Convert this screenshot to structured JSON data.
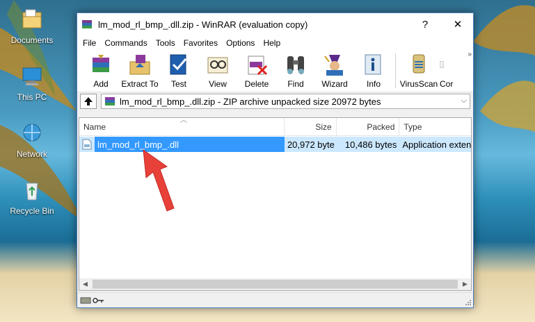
{
  "desktop": {
    "icons": [
      {
        "label": "Documents",
        "icon": "documents-folder-icon"
      },
      {
        "label": "This PC",
        "icon": "computer-icon"
      },
      {
        "label": "Network",
        "icon": "network-icon"
      },
      {
        "label": "Recycle Bin",
        "icon": "recycle-bin-icon"
      }
    ]
  },
  "window": {
    "title": "lm_mod_rl_bmp_.dll.zip - WinRAR (evaluation copy)",
    "help_button": "?",
    "close_button": "✕"
  },
  "menu": [
    "File",
    "Commands",
    "Tools",
    "Favorites",
    "Options",
    "Help"
  ],
  "toolbar": {
    "buttons": [
      {
        "label": "Add",
        "icon": "add-archive-icon"
      },
      {
        "label": "Extract To",
        "icon": "extract-to-icon"
      },
      {
        "label": "Test",
        "icon": "test-icon"
      },
      {
        "label": "View",
        "icon": "view-icon"
      },
      {
        "label": "Delete",
        "icon": "delete-icon"
      },
      {
        "label": "Find",
        "icon": "find-icon"
      },
      {
        "label": "Wizard",
        "icon": "wizard-icon"
      },
      {
        "label": "Info",
        "icon": "info-icon"
      },
      {
        "label": "VirusScan",
        "icon": "virusscan-icon"
      },
      {
        "label": "Cor",
        "icon": "comment-icon"
      }
    ],
    "overflow": "»"
  },
  "address": {
    "path": "lm_mod_rl_bmp_.dll.zip - ZIP archive unpacked size 20972 bytes"
  },
  "list": {
    "columns": [
      "Name",
      "Size",
      "Packed",
      "Type"
    ],
    "rows": [
      {
        "name": "lm_mod_rl_bmp_.dll",
        "size": "20,972 byte",
        "packed": "10,486 bytes",
        "type": "Application exten"
      }
    ]
  },
  "colors": {
    "selection": "#3399ff",
    "row_highlight": "#cce8ff",
    "arrow": "#e8413a",
    "window_border": "#4a7cbc"
  }
}
